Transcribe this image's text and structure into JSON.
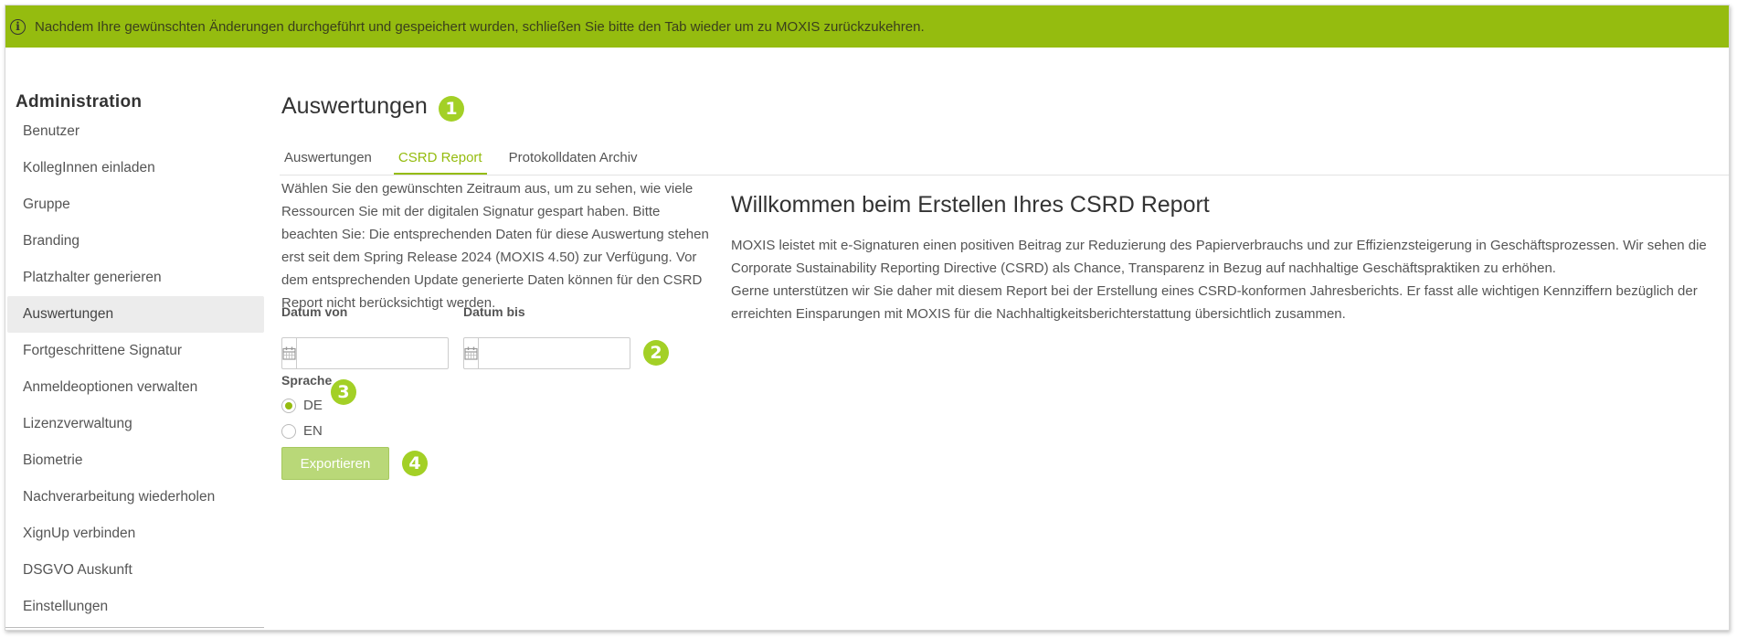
{
  "banner": {
    "message": "Nachdem Ihre gewünschten Änderungen durchgeführt und gespeichert wurden, schließen Sie bitte den Tab wieder um zu MOXIS zurückzukehren.",
    "icon": "info-icon",
    "color": "#95bc0f"
  },
  "sidebar": {
    "heading": "Administration",
    "items": [
      {
        "label": "Benutzer"
      },
      {
        "label": "KollegInnen einladen"
      },
      {
        "label": "Gruppe"
      },
      {
        "label": "Branding"
      },
      {
        "label": "Platzhalter generieren"
      },
      {
        "label": "Auswertungen",
        "active": true
      },
      {
        "label": "Fortgeschrittene Signatur"
      },
      {
        "label": "Anmeldeoptionen verwalten"
      },
      {
        "label": "Lizenzverwaltung"
      },
      {
        "label": "Biometrie"
      },
      {
        "label": "Nachverarbeitung wiederholen"
      },
      {
        "label": "XignUp verbinden"
      },
      {
        "label": "DSGVO Auskunft"
      },
      {
        "label": "Einstellungen"
      }
    ]
  },
  "main": {
    "title": "Auswertungen",
    "tabs": [
      {
        "label": "Auswertungen"
      },
      {
        "label": "CSRD Report",
        "active": true
      },
      {
        "label": "Protokolldaten Archiv"
      }
    ],
    "description": "Wählen Sie den gewünschten Zeitraum aus, um zu sehen, wie viele Ressourcen Sie mit der digitalen Signatur gespart haben. Bitte beachten Sie: Die entsprechenden Daten für diese Auswertung stehen erst seit dem Spring Release 2024 (MOXIS 4.50) zur Verfügung. Vor dem entsprechenden Update generierte Daten können für den CSRD Report nicht berücksichtigt werden.",
    "date_from": {
      "label": "Datum von",
      "value": ""
    },
    "date_to": {
      "label": "Datum bis",
      "value": ""
    },
    "language": {
      "label": "Sprache",
      "options": [
        {
          "label": "DE",
          "selected": true
        },
        {
          "label": "EN",
          "selected": false
        }
      ]
    },
    "export_label": "Exportieren",
    "welcome": {
      "title": "Willkommen beim Erstellen Ihres CSRD Report",
      "paragraph1": "MOXIS leistet mit e-Signaturen einen positiven Beitrag zur Reduzierung des Papierverbrauchs und zur Effizienzsteigerung in Geschäftsprozessen. Wir sehen die Corporate Sustainability Reporting Directive (CSRD) als Chance, Transparenz in Bezug auf nachhaltige Geschäftspraktiken zu erhöhen.",
      "paragraph2": "Gerne unterstützen wir Sie daher mit diesem Report bei der Erstellung eines CSRD-konformen Jahresberichts. Er fasst alle wichtigen Kennziffern bezüglich der erreichten Einsparungen mit MOXIS für die Nachhaltigkeitsberichterstattung übersichtlich zusammen."
    }
  },
  "annotations": [
    "1",
    "2",
    "3",
    "4"
  ],
  "colors": {
    "accent": "#95bc0f",
    "badge": "#a3d026",
    "export_button": "#b9d878"
  }
}
